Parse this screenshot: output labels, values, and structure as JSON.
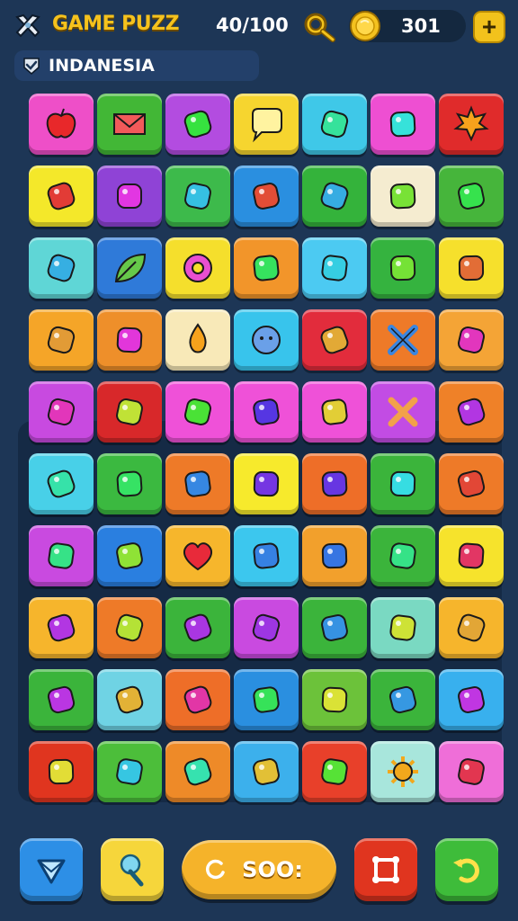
{
  "header": {
    "title": "GAME PUZZ",
    "score": "40/100",
    "coins": "301",
    "plus_label": "+"
  },
  "region": {
    "label": "INDANESIA"
  },
  "board": {
    "rows": [
      [
        {
          "color": "#ee4fc8",
          "icon": "apple-icon"
        },
        {
          "color": "#42b736",
          "icon": "envelope-icon"
        },
        {
          "color": "#b34ce0",
          "icon": "creature-face-icon"
        },
        {
          "color": "#f6d52f",
          "icon": "speech-bubble-icon"
        },
        {
          "color": "#3fc8e8",
          "icon": "fruit-bowl-icon"
        },
        {
          "color": "#ee4fd2",
          "icon": "wrapped-candy-icon"
        },
        {
          "color": "#e02b2b",
          "icon": "maple-leaf-icon"
        }
      ],
      [
        {
          "color": "#f4e82a",
          "icon": "eraser-icon"
        },
        {
          "color": "#8f43d6",
          "icon": "robot-icon"
        },
        {
          "color": "#3dba4b",
          "icon": "shop-icon"
        },
        {
          "color": "#2a8fe0",
          "icon": "chili-pepper-icon"
        },
        {
          "color": "#34b33b",
          "icon": "strawberry-icon"
        },
        {
          "color": "#f5ecd0",
          "icon": "camera-icon"
        },
        {
          "color": "#46b53b",
          "icon": "potion-bag-icon"
        }
      ],
      [
        {
          "color": "#5fd6d6",
          "icon": "open-box-icon"
        },
        {
          "color": "#2f7ad9",
          "icon": "leaf-icon"
        },
        {
          "color": "#f5df2c",
          "icon": "donut-icon"
        },
        {
          "color": "#f2952a",
          "icon": "pretzel-icon"
        },
        {
          "color": "#4ccaf2",
          "icon": "jar-icon"
        },
        {
          "color": "#35b33f",
          "icon": "bug-icon"
        },
        {
          "color": "#f6e02c",
          "icon": "lemon-icon"
        }
      ],
      [
        {
          "color": "#f5a528",
          "icon": "treasure-chest-icon"
        },
        {
          "color": "#ee8f2a",
          "icon": "arch-window-icon"
        },
        {
          "color": "#f8e9b8",
          "icon": "flame-icon"
        },
        {
          "color": "#38c4ec",
          "icon": "button-face-icon"
        },
        {
          "color": "#e22c3c",
          "icon": "bottle-icon"
        },
        {
          "color": "#ee7a28",
          "icon": "cross-icon"
        },
        {
          "color": "#f4a436",
          "icon": "popsicle-icon"
        }
      ],
      [
        {
          "color": "#c84ae0",
          "icon": "projector-icon"
        },
        {
          "color": "#d8282a",
          "icon": "crayon-icon"
        },
        {
          "color": "#ef51d8",
          "icon": "lime-icon"
        },
        {
          "color": "#ef51d8",
          "icon": "carrot-icon"
        },
        {
          "color": "#ef51d8",
          "icon": "palm-tree-icon"
        },
        {
          "color": "#c24ce4",
          "icon": "crossed-bones-icon"
        },
        {
          "color": "#ef8128",
          "icon": "paint-brush-icon"
        }
      ],
      [
        {
          "color": "#48d0e8",
          "icon": "gift-box-icon"
        },
        {
          "color": "#3bb940",
          "icon": "letter-icon"
        },
        {
          "color": "#ee7a28",
          "icon": "marker-icon"
        },
        {
          "color": "#f7ea2c",
          "icon": "stick-icon"
        },
        {
          "color": "#ee6e28",
          "icon": "lipstick-icon"
        },
        {
          "color": "#3bb43b",
          "icon": "green-brush-icon"
        },
        {
          "color": "#ee7a28",
          "icon": "ice-cream-cone-icon"
        }
      ],
      [
        {
          "color": "#c94ae0",
          "icon": "candy-pile-icon"
        },
        {
          "color": "#2a7fe0",
          "icon": "banana-icon"
        },
        {
          "color": "#f6b62c",
          "icon": "heart-icon"
        },
        {
          "color": "#3cc7ee",
          "icon": "corn-icon"
        },
        {
          "color": "#f2a02c",
          "icon": "rocket-icon"
        },
        {
          "color": "#3bb43b",
          "icon": "brush-icon"
        },
        {
          "color": "#f6e32c",
          "icon": "boy-face-icon"
        }
      ],
      [
        {
          "color": "#f6b52c",
          "icon": "pencil-tip-icon"
        },
        {
          "color": "#ee7a28",
          "icon": "monster-icon"
        },
        {
          "color": "#3bb43b",
          "icon": "red-apple-icon"
        },
        {
          "color": "#c94ae0",
          "icon": "bandage-icon"
        },
        {
          "color": "#3bb43b",
          "icon": "berry-icon"
        },
        {
          "color": "#7ad9c2",
          "icon": "hedgehog-icon"
        },
        {
          "color": "#f6b52c",
          "icon": "scissors-icon"
        }
      ],
      [
        {
          "color": "#3bb43b",
          "icon": "glue-stick-icon"
        },
        {
          "color": "#6fd3e4",
          "icon": "toy-bear-icon"
        },
        {
          "color": "#ee6e28",
          "icon": "blue-marker-icon"
        },
        {
          "color": "#2a8fe0",
          "icon": "drumstick-icon"
        },
        {
          "color": "#6cc23a",
          "icon": "gem-icon"
        },
        {
          "color": "#3bb43b",
          "icon": "fish-icon"
        },
        {
          "color": "#38b0ee",
          "icon": "yellow-pencil-icon"
        }
      ],
      [
        {
          "color": "#e0351f",
          "icon": "cocoa-bean-icon"
        },
        {
          "color": "#4cbe3a",
          "icon": "green-bandage-icon"
        },
        {
          "color": "#ee8a28",
          "icon": "teal-lock-icon"
        },
        {
          "color": "#3cb0ec",
          "icon": "cookie-face-icon"
        },
        {
          "color": "#e8402a",
          "icon": "teal-ring-icon"
        },
        {
          "color": "#a8e6dc",
          "icon": "sun-gear-icon"
        },
        {
          "color": "#ef6ed8",
          "icon": "doll-face-icon"
        }
      ]
    ]
  },
  "bottom_bar": {
    "main_label": "SOO:",
    "hint": "hint",
    "freeze": "freeze",
    "shuffle": "shuffle",
    "undo": "undo"
  }
}
